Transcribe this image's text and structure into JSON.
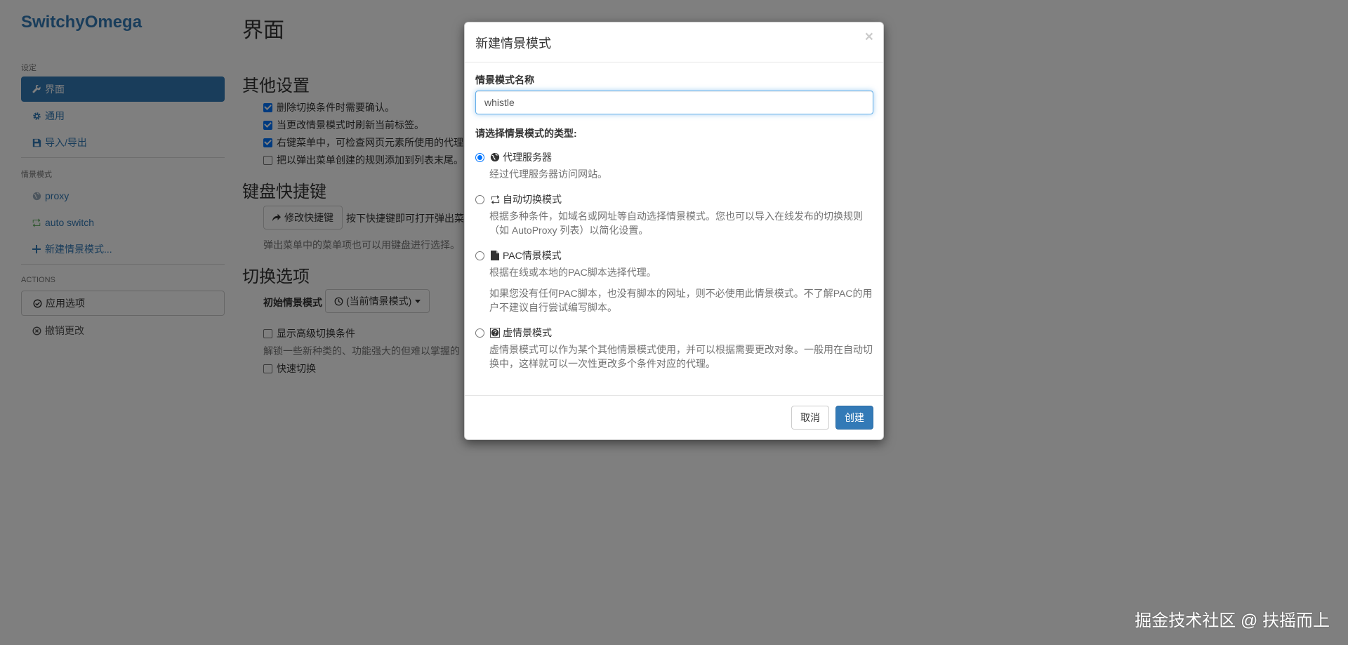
{
  "brand": "SwitchyOmega",
  "sidebar": {
    "settings_header": "设定",
    "settings_items": [
      {
        "label": "界面",
        "icon": "wrench-icon"
      },
      {
        "label": "通用",
        "icon": "gear-icon"
      },
      {
        "label": "导入/导出",
        "icon": "floppy-icon"
      }
    ],
    "profiles_header": "情景模式",
    "profile_items": [
      {
        "label": "proxy",
        "icon": "globe-icon"
      },
      {
        "label": "auto switch",
        "icon": "retweet-icon"
      },
      {
        "label": "新建情景模式...",
        "icon": "plus-icon"
      }
    ],
    "actions_header": "ACTIONS",
    "action_items": [
      {
        "label": "应用选项",
        "icon": "check-circle-icon"
      },
      {
        "label": "撤销更改",
        "icon": "x-circle-icon"
      }
    ]
  },
  "main": {
    "title": "界面",
    "other_settings": {
      "heading": "其他设置",
      "options": [
        {
          "label": "删除切换条件时需要确认。",
          "checked": true
        },
        {
          "label": "当更改情景模式时刷新当前标签。",
          "checked": true
        },
        {
          "label": "右键菜单中，可检查网页元素所使用的代理",
          "checked": true
        },
        {
          "label": "把以弹出菜单创建的规则添加到列表末尾。",
          "checked": false
        }
      ]
    },
    "shortcuts": {
      "heading": "键盘快捷键",
      "button": "修改快捷键",
      "hint": "按下快捷键即可打开弹出菜",
      "help": "弹出菜单中的菜单项也可以用键盘进行选择。"
    },
    "switch_options": {
      "heading": "切换选项",
      "initial_label": "初始情景模式",
      "initial_value": "(当前情景模式)",
      "advanced_label": "显示高级切换条件",
      "advanced_help": "解锁一些新种类的、功能强大的但难以掌握的",
      "quick_label": "快速切换"
    }
  },
  "modal": {
    "title": "新建情景模式",
    "close": "×",
    "name_label": "情景模式名称",
    "name_value": "whistle",
    "type_label": "请选择情景模式的类型:",
    "types": [
      {
        "label": "代理服务器",
        "icon": "globe-icon",
        "checked": true,
        "desc": [
          "经过代理服务器访问网站。"
        ]
      },
      {
        "label": "自动切换模式",
        "icon": "retweet-icon",
        "checked": false,
        "desc": [
          "根据多种条件，如域名或网址等自动选择情景模式。您也可以导入在线发布的切换规则（如 AutoProxy 列表）以简化设置。"
        ]
      },
      {
        "label": "PAC情景模式",
        "icon": "file-icon",
        "checked": false,
        "desc": [
          "根据在线或本地的PAC脚本选择代理。",
          "如果您没有任何PAC脚本，也没有脚本的网址，则不必使用此情景模式。不了解PAC的用户不建议自行尝试编写脚本。"
        ]
      },
      {
        "label": "虚情景模式",
        "icon": "question-globe-icon",
        "checked": false,
        "desc": [
          "虚情景模式可以作为某个其他情景模式使用，并可以根据需要更改对象。一般用在自动切换中，这样就可以一次性更改多个条件对应的代理。"
        ]
      }
    ],
    "cancel": "取消",
    "create": "创建"
  },
  "watermark": "掘金技术社区 @ 扶摇而上"
}
